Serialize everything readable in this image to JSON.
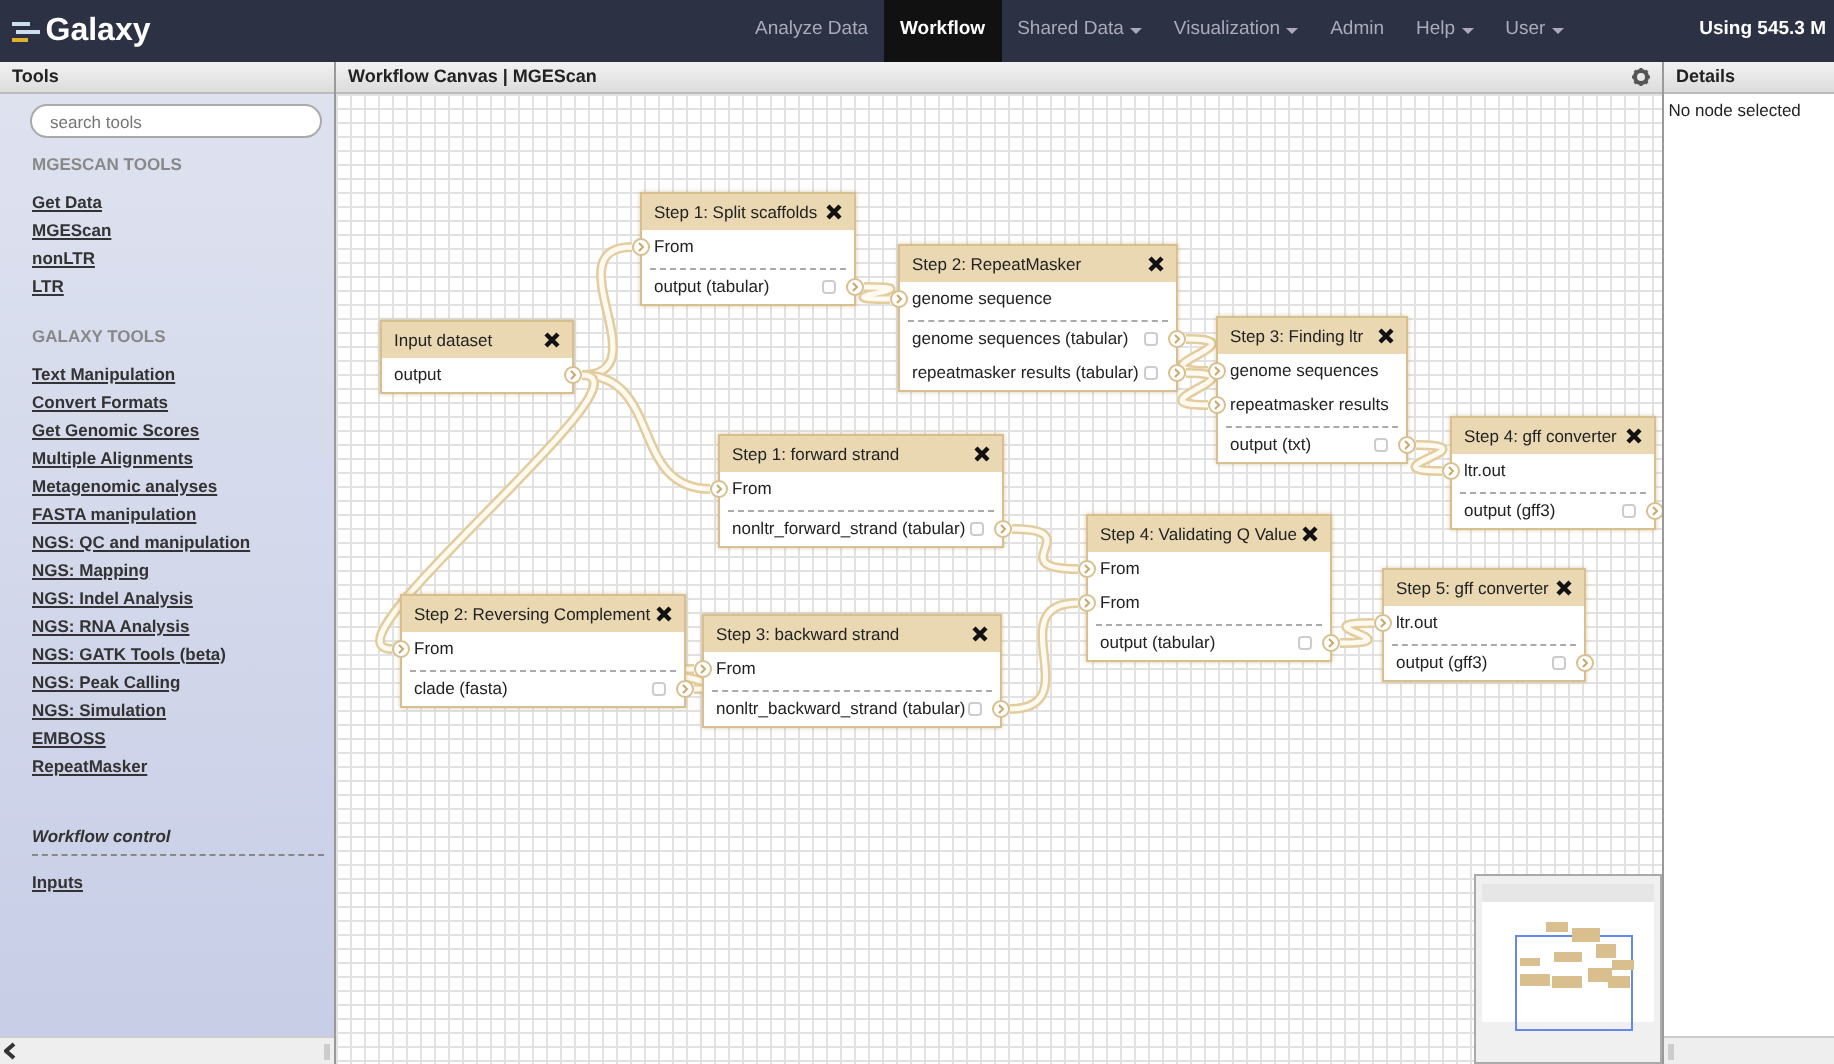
{
  "brand": {
    "title": "Galaxy"
  },
  "nav": [
    {
      "label": "Analyze Data",
      "selected": false,
      "dropdown": false
    },
    {
      "label": "Workflow",
      "selected": true,
      "dropdown": false
    },
    {
      "label": "Shared Data",
      "selected": false,
      "dropdown": true
    },
    {
      "label": "Visualization",
      "selected": false,
      "dropdown": true
    },
    {
      "label": "Admin",
      "selected": false,
      "dropdown": false
    },
    {
      "label": "Help",
      "selected": false,
      "dropdown": true
    },
    {
      "label": "User",
      "selected": false,
      "dropdown": true
    }
  ],
  "usage": "Using 545.3 M",
  "tools_panel": {
    "title": "Tools",
    "search": {
      "placeholder": "search tools"
    },
    "sections": [
      {
        "kind": "heading",
        "title": "MGESCAN TOOLS",
        "items": [
          "Get Data",
          "MGEScan",
          "nonLTR",
          "LTR"
        ]
      },
      {
        "kind": "heading",
        "title": "GALAXY TOOLS",
        "items": [
          "Text Manipulation",
          "Convert Formats",
          "Get Genomic Scores",
          "Multiple Alignments",
          "Metagenomic analyses",
          "FASTA manipulation",
          "NGS: QC and manipulation",
          "NGS: Mapping",
          "NGS: Indel Analysis",
          "NGS: RNA Analysis",
          "NGS: GATK Tools (beta)",
          "NGS: Peak Calling",
          "NGS: Simulation",
          "EMBOSS",
          "RepeatMasker"
        ]
      },
      {
        "kind": "label",
        "title": "Workflow control",
        "items": [
          "Inputs"
        ]
      }
    ]
  },
  "canvas": {
    "title": "Workflow Canvas | MGEScan",
    "nodes": [
      {
        "title": "Input dataset",
        "outputs": [
          {
            "label": "output"
          }
        ]
      },
      {
        "title": "Step 1: Split scaffolds",
        "inputs": [
          "From"
        ],
        "outputs": [
          {
            "label": "output (tabular)",
            "checked": false
          }
        ]
      },
      {
        "title": "Step 2: RepeatMasker",
        "inputs": [
          "genome sequence"
        ],
        "outputs": [
          {
            "label": "genome sequences (tabular)",
            "checked": false
          },
          {
            "label": "repeatmasker results (tabular)",
            "checked": false
          }
        ]
      },
      {
        "title": "Step 3: Finding ltr",
        "inputs": [
          "genome sequences",
          "repeatmasker results"
        ],
        "outputs": [
          {
            "label": "output (txt)",
            "checked": false
          }
        ]
      },
      {
        "title": "Step 4: gff converter",
        "inputs": [
          "ltr.out"
        ],
        "outputs": [
          {
            "label": "output (gff3)",
            "checked": false
          }
        ]
      },
      {
        "title": "Step 1: forward strand",
        "inputs": [
          "From"
        ],
        "outputs": [
          {
            "label": "nonltr_forward_strand (tabular)",
            "checked": false
          }
        ]
      },
      {
        "title": "Step 4: Validating Q Value",
        "inputs": [
          "From",
          "From"
        ],
        "outputs": [
          {
            "label": "output (tabular)",
            "checked": false
          }
        ]
      },
      {
        "title": "Step 5: gff converter",
        "inputs": [
          "ltr.out"
        ],
        "outputs": [
          {
            "label": "output (gff3)",
            "checked": false
          }
        ]
      },
      {
        "title": "Step 2: Reversing Complement",
        "inputs": [
          "From"
        ],
        "outputs": [
          {
            "label": "clade (fasta)",
            "checked": false
          }
        ]
      },
      {
        "title": "Step 3: backward strand",
        "inputs": [
          "From"
        ],
        "outputs": [
          {
            "label": "nonltr_backward_strand (tabular)",
            "checked": false
          }
        ]
      }
    ]
  },
  "details_panel": {
    "title": "Details",
    "message": "No node selected"
  }
}
